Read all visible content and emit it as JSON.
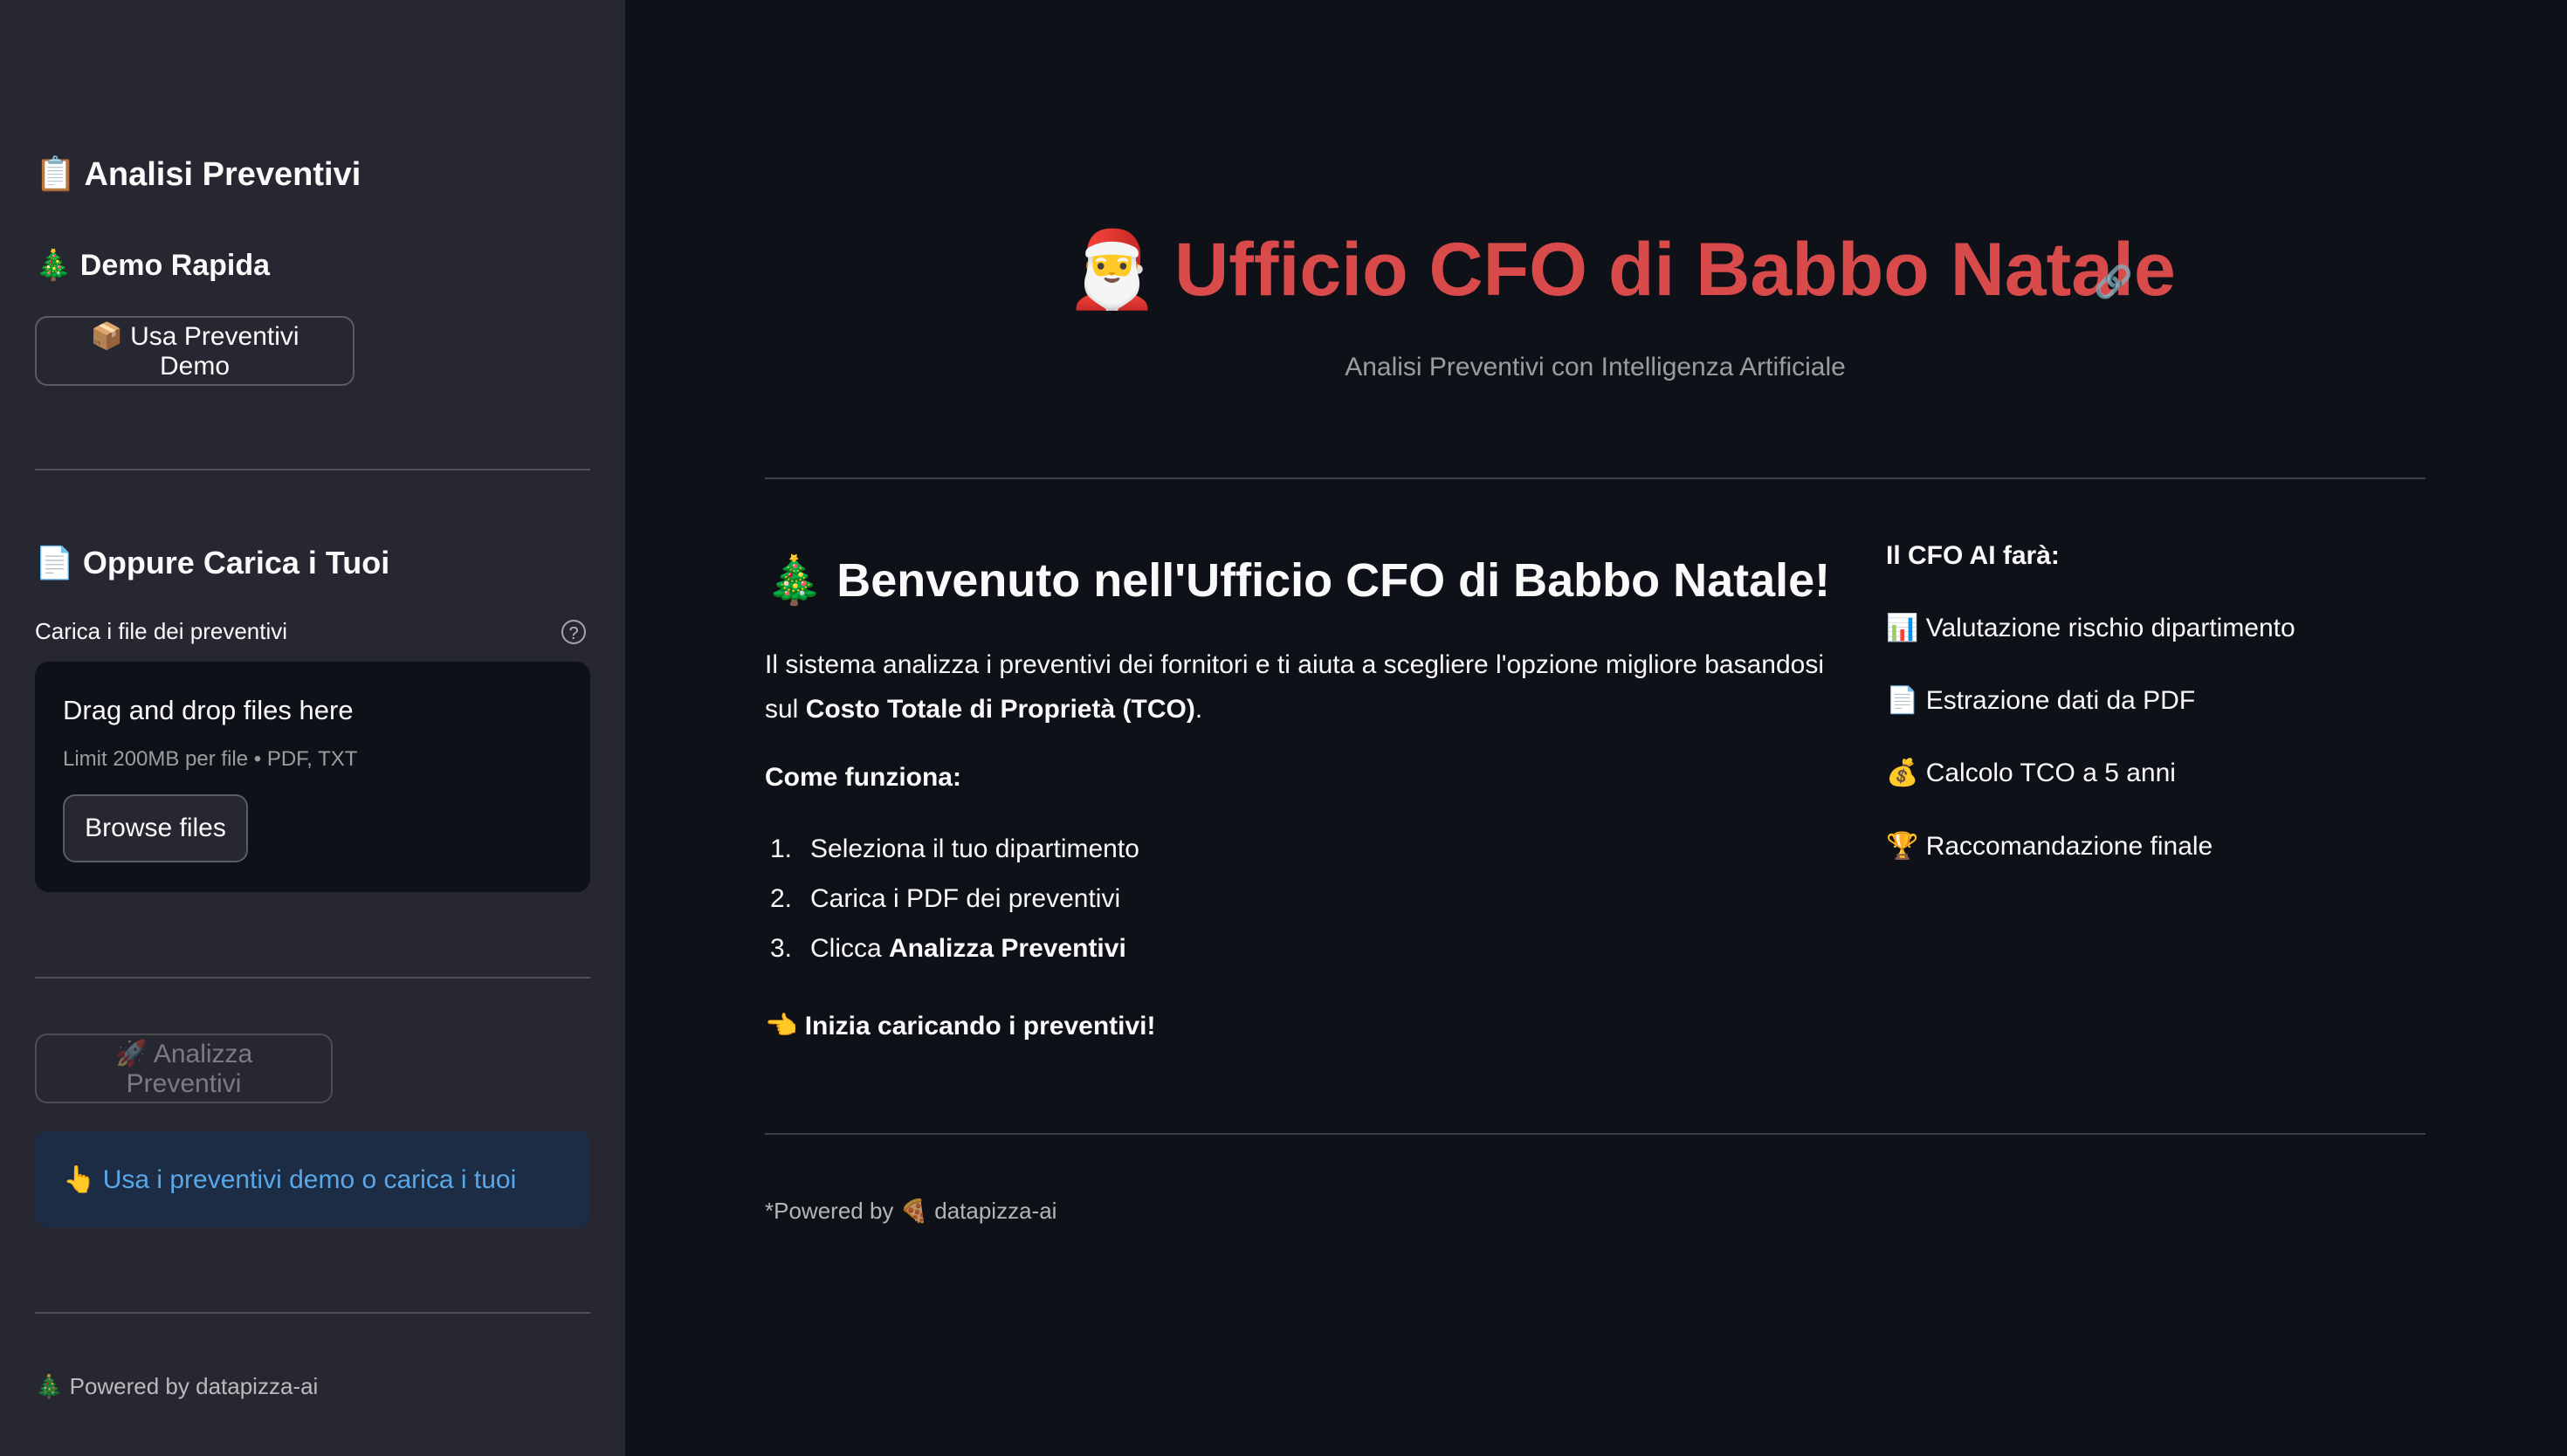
{
  "sidebar": {
    "title": "📋 Analisi Preventivi",
    "demo_heading": "🎄 Demo Rapida",
    "demo_button": "📦 Usa Preventivi Demo",
    "upload_heading": "📄 Oppure Carica i Tuoi",
    "upload_label": "Carica i file dei preventivi",
    "help_icon_glyph": "?",
    "dropzone": {
      "title": "Drag and drop files here",
      "limit": "Limit 200MB per file • PDF, TXT",
      "browse_button": "Browse files"
    },
    "analyze_button": "🚀 Analizza Preventivi",
    "info_message": "👆 Usa i preventivi demo o carica i tuoi",
    "footer": "🎄 Powered by datapizza-ai"
  },
  "main": {
    "title_emoji": "🎅",
    "title": "Ufficio CFO di Babbo Natale",
    "link_icon_glyph": "🔗",
    "subtitle": "Analisi Preventivi con Intelligenza Artificiale",
    "welcome_heading": "🎄 Benvenuto nell'Ufficio CFO di Babbo Natale!",
    "intro_text": "Il sistema analizza i preventivi dei fornitori e ti aiuta a scegliere l'opzione migliore basandosi sul ",
    "intro_bold": "Costo Totale di Proprietà (TCO)",
    "intro_end": ".",
    "how_heading": "Come funziona:",
    "steps": [
      {
        "num": "1.",
        "text": "Seleziona il tuo dipartimento",
        "bold": ""
      },
      {
        "num": "2.",
        "text": "Carica i PDF dei preventivi",
        "bold": ""
      },
      {
        "num": "3.",
        "text": "Clicca ",
        "bold": "Analizza Preventivi"
      }
    ],
    "start_text": "👈 Inizia caricando i preventivi!",
    "ai_heading": "Il CFO AI farà:",
    "features": [
      "📊 Valutazione rischio dipartimento",
      "📄 Estrazione dati da PDF",
      "💰 Calcolo TCO a 5 anni",
      "🏆 Raccomandazione finale"
    ],
    "footer": "*Powered by 🍕 datapizza-ai"
  },
  "colors": {
    "background": "#0e1117",
    "sidebar": "#262730",
    "title_red": "#d94b4b",
    "info_bg": "#1c2c44",
    "info_text": "#5aa7e8"
  }
}
